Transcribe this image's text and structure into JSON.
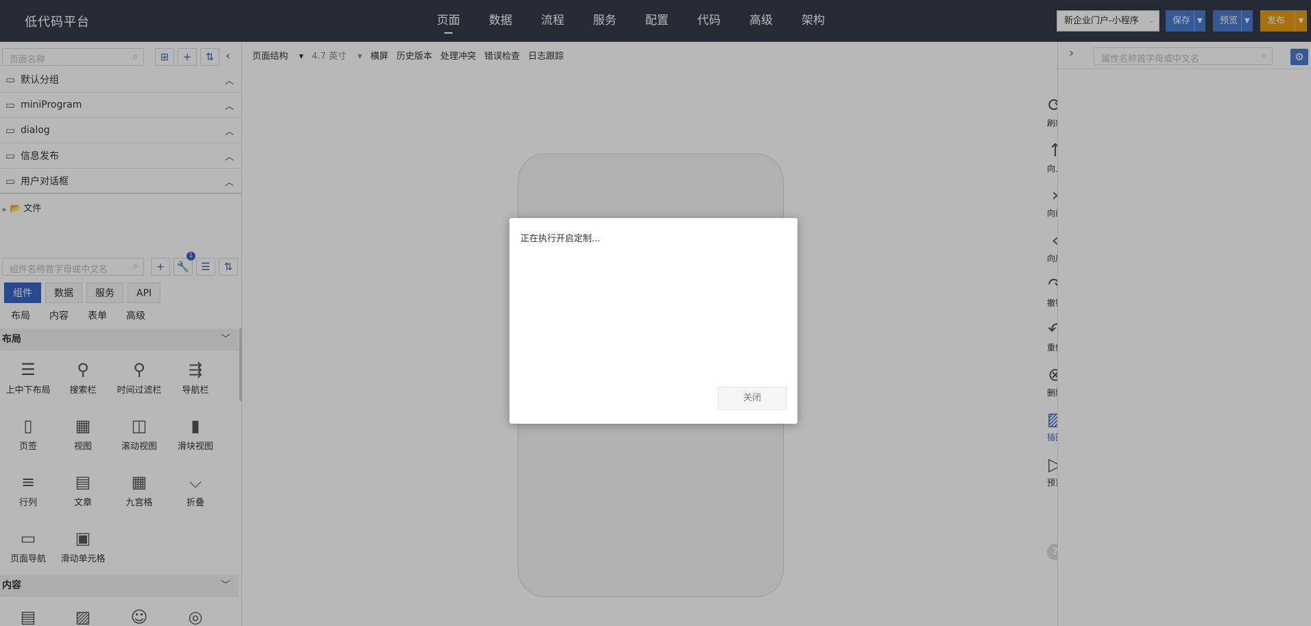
{
  "app": {
    "title": "低代码平台",
    "nav": [
      "页面",
      "数据",
      "流程",
      "服务",
      "配置",
      "代码",
      "高级",
      "架构"
    ],
    "project": "新企业门户-小程序",
    "save": "保存",
    "preview": "预览",
    "publish": "发布",
    "accent_color": "#4a7bd0",
    "publish_color": "#e89d12"
  },
  "left": {
    "page_search_placeholder": "页面名称",
    "groups": [
      "默认分组",
      "miniProgram",
      "dialog",
      "信息发布",
      "用户对话框"
    ],
    "file_node": "文件",
    "comp_search_placeholder": "组件名称首字母或中文名",
    "badge_count": "1",
    "tabs": [
      "组件",
      "数据",
      "服务",
      "API"
    ],
    "subtabs": [
      "布局",
      "内容",
      "表单",
      "高级"
    ],
    "section_layout": "布局",
    "section_content": "内容",
    "layout_components": [
      {
        "label": "上中下布局",
        "icon": "stack-icon"
      },
      {
        "label": "搜索栏",
        "icon": "search-icon"
      },
      {
        "label": "时间过滤栏",
        "icon": "search-icon"
      },
      {
        "label": "导航栏",
        "icon": "navbar-icon"
      },
      {
        "label": "页签",
        "icon": "tab-icon"
      },
      {
        "label": "视图",
        "icon": "grid-view-icon"
      },
      {
        "label": "滚动视图",
        "icon": "scroll-view-icon"
      },
      {
        "label": "滑块视图",
        "icon": "slider-view-icon"
      },
      {
        "label": "行列",
        "icon": "list-icon"
      },
      {
        "label": "文章",
        "icon": "article-icon"
      },
      {
        "label": "九宫格",
        "icon": "nine-grid-icon"
      },
      {
        "label": "折叠",
        "icon": "collapse-icon"
      },
      {
        "label": "页面导航",
        "icon": "page-nav-icon"
      },
      {
        "label": "滑动单元格",
        "icon": "swipe-cell-icon"
      }
    ]
  },
  "center": {
    "toolbar": {
      "structure": "页面结构",
      "size": "4.7 英寸",
      "landscape": "横屏",
      "history": "历史版本",
      "conflict": "处理冲突",
      "error_check": "错误检查",
      "log": "日志跟踪"
    },
    "side_tools": [
      "刷新",
      "向上",
      "向前",
      "向后",
      "撤销",
      "重做",
      "删除",
      "插图",
      "预览"
    ],
    "help": "?"
  },
  "right": {
    "search_placeholder": "属性名称首字母或中文名"
  },
  "modal": {
    "message": "正在执行开启定制...",
    "close": "关闭"
  }
}
